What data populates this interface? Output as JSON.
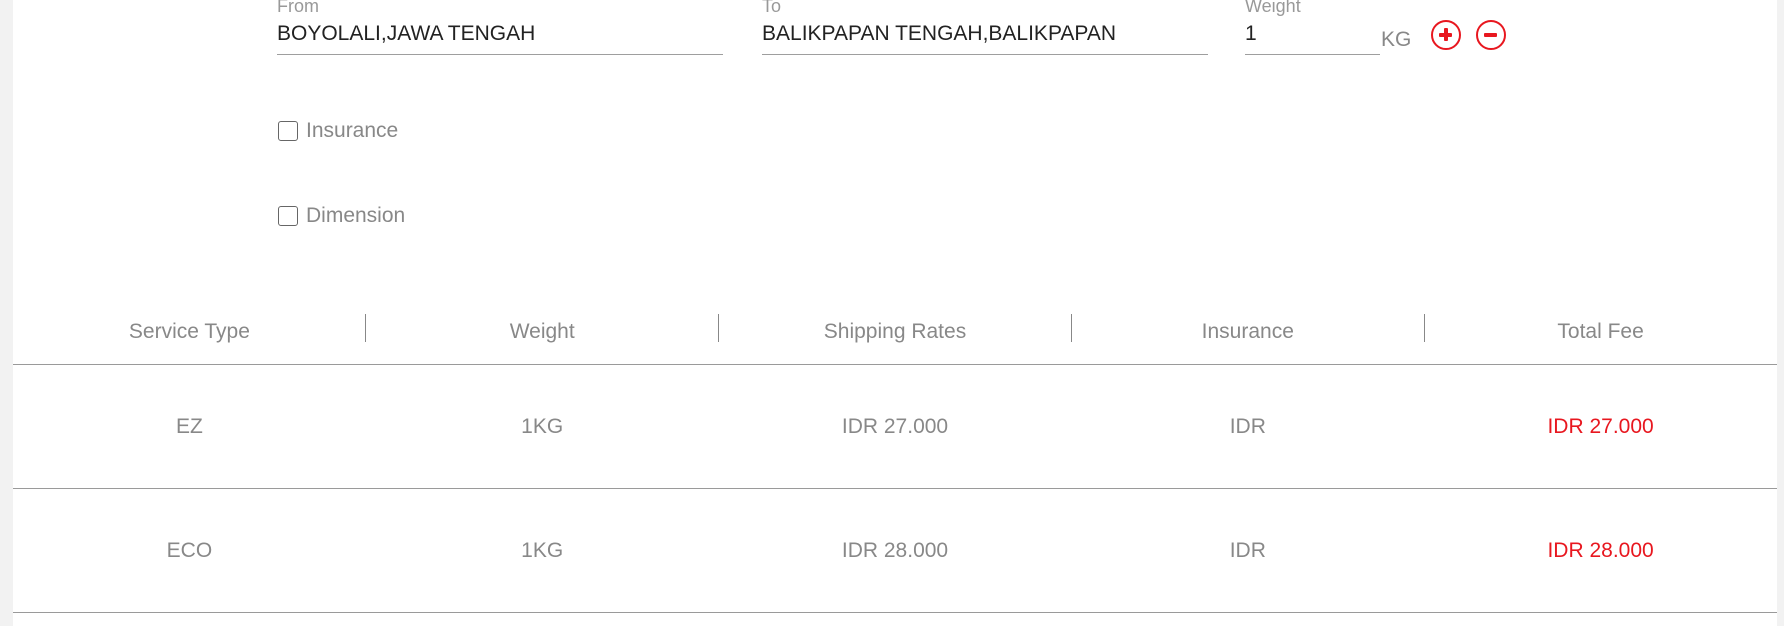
{
  "form": {
    "from": {
      "label": "From",
      "value": "BOYOLALI,JAWA TENGAH"
    },
    "to": {
      "label": "To",
      "value": "BALIKPAPAN TENGAH,BALIKPAPAN"
    },
    "weight": {
      "label": "Weight",
      "value": "1",
      "unit": "KG"
    },
    "buttons": {
      "increase_icon": "plus-circle-icon",
      "decrease_icon": "minus-circle-icon"
    },
    "options": {
      "insurance_label": "Insurance",
      "dimension_label": "Dimension"
    }
  },
  "table": {
    "headers": [
      "Service Type",
      "Weight",
      "Shipping Rates",
      "Insurance",
      "Total Fee"
    ],
    "rows": [
      {
        "service": "EZ",
        "weight": "1KG",
        "rate": "IDR 27.000",
        "insurance": "IDR",
        "total": "IDR 27.000"
      },
      {
        "service": "ECO",
        "weight": "1KG",
        "rate": "IDR 28.000",
        "insurance": "IDR",
        "total": "IDR 28.000"
      }
    ]
  },
  "colors": {
    "accent": "#e8171f",
    "text": "#888888"
  }
}
